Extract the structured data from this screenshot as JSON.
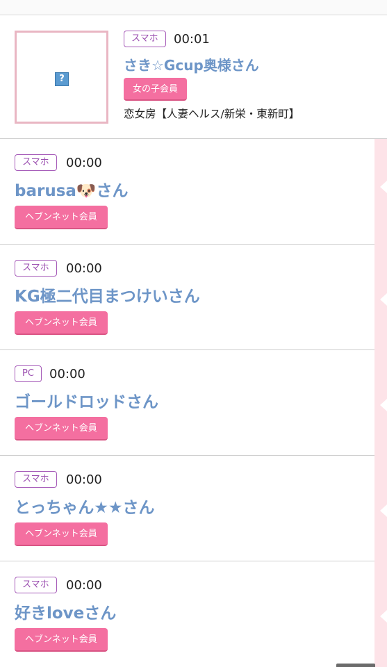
{
  "featured": {
    "device": "スマホ",
    "time": "00:01",
    "name": "さき☆Gcup奥様さん",
    "member_type": "女の子会員",
    "shop": "恋女房【人妻ヘルス/新栄・東新町】",
    "image_placeholder": "?"
  },
  "visitors": [
    {
      "device": "スマホ",
      "time": "00:00",
      "name": "barusa🐶さん",
      "member_type": "ヘブンネット会員"
    },
    {
      "device": "スマホ",
      "time": "00:00",
      "name": "KG極二代目まつけいさん",
      "member_type": "ヘブンネット会員"
    },
    {
      "device": "PC",
      "time": "00:00",
      "name": "ゴールドロッドさん",
      "member_type": "ヘブンネット会員"
    },
    {
      "device": "スマホ",
      "time": "00:00",
      "name": "とっちゃん★★さん",
      "member_type": "ヘブンネット会員"
    },
    {
      "device": "スマホ",
      "time": "00:00",
      "name": "好きloveさん",
      "member_type": "ヘブンネット会員"
    }
  ],
  "colors": {
    "name_link": "#6d95c7",
    "device_badge": "#9b4fb0",
    "member_badge": "#f46fa0",
    "thumb_border": "#e9b6c3",
    "side_rail": "#fde3e8"
  }
}
